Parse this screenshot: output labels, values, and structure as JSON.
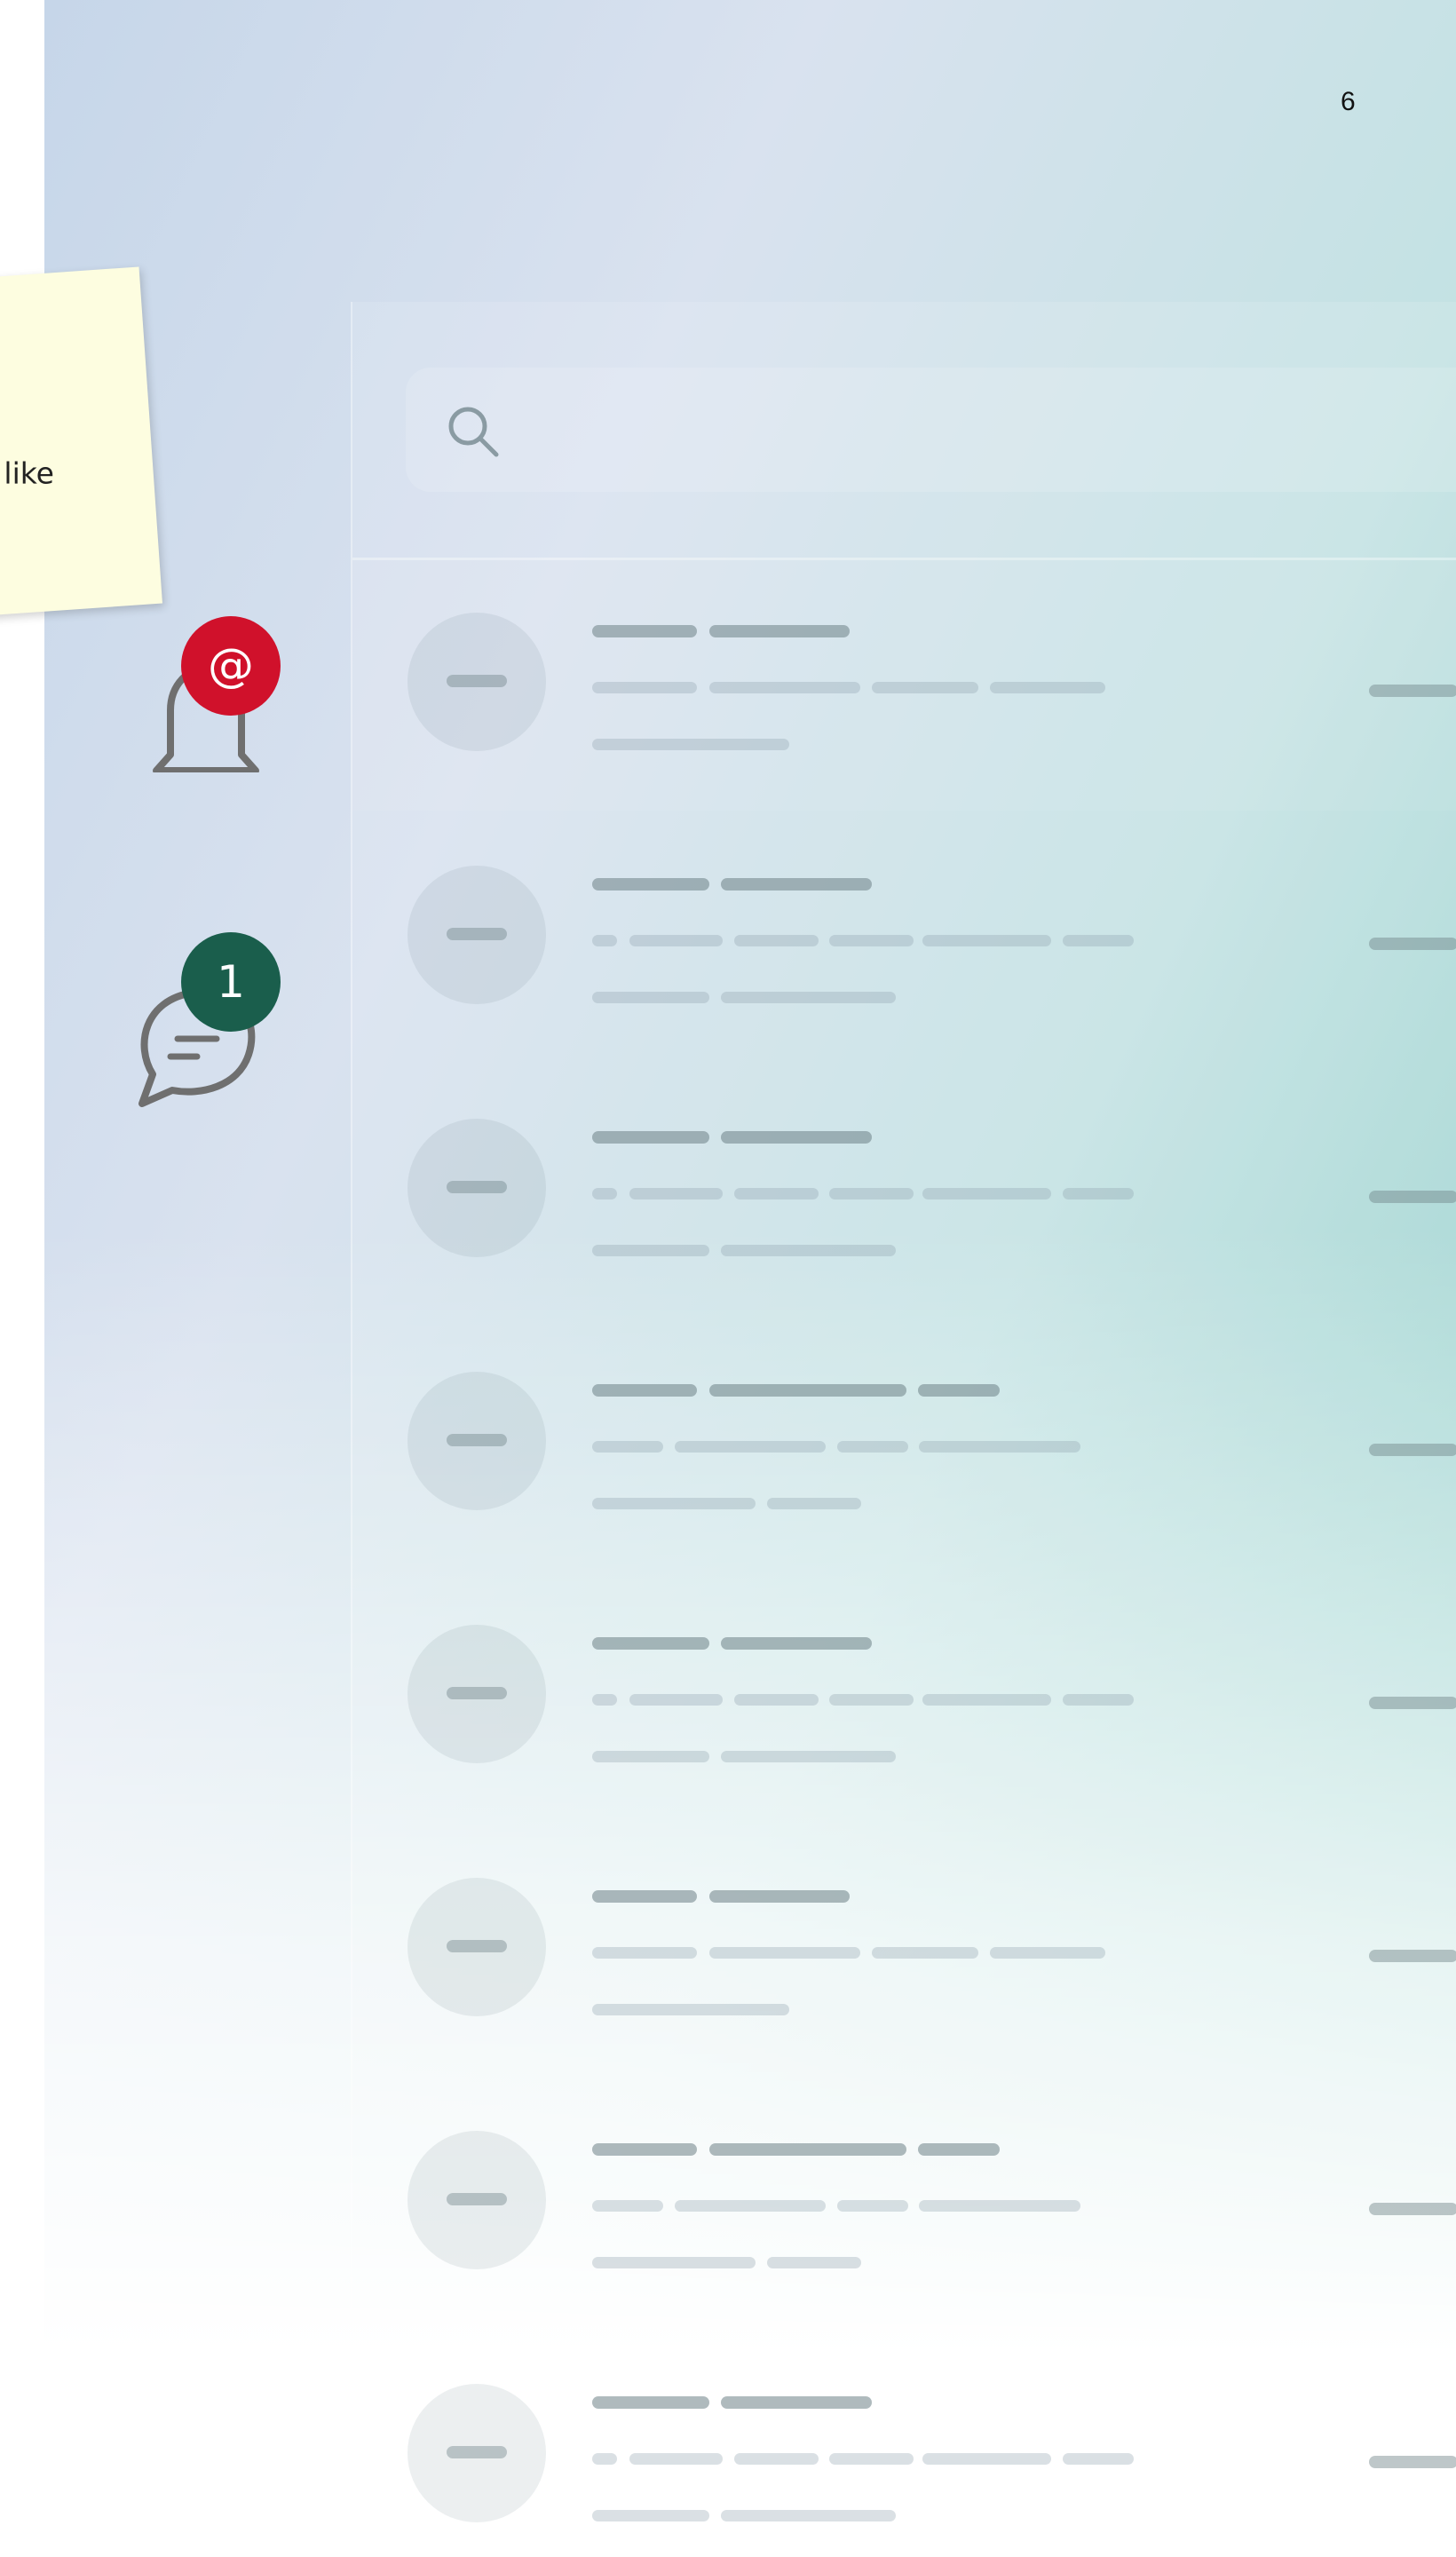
{
  "page": {
    "number": "6"
  },
  "sticky_note": {
    "text": "like"
  },
  "notifications": {
    "mention_badge": "@",
    "message_badge": "1",
    "mention_badge_color": "#d0112b",
    "message_badge_color": "#1a5e4c"
  },
  "icons": [
    "bell-icon",
    "chat-bubble-icon",
    "search-icon"
  ],
  "colors": {
    "background_gradient_start": "#c6d6e9",
    "background_gradient_end": "#7ec8c0",
    "sticky_note": "#fdfde0"
  }
}
